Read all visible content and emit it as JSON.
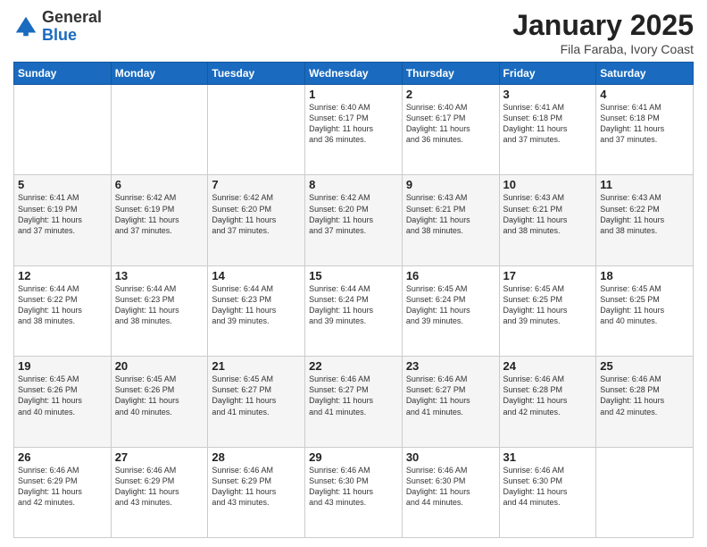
{
  "logo": {
    "general": "General",
    "blue": "Blue"
  },
  "header": {
    "title": "January 2025",
    "subtitle": "Fila Faraba, Ivory Coast"
  },
  "weekdays": [
    "Sunday",
    "Monday",
    "Tuesday",
    "Wednesday",
    "Thursday",
    "Friday",
    "Saturday"
  ],
  "weeks": [
    [
      {
        "day": "",
        "info": ""
      },
      {
        "day": "",
        "info": ""
      },
      {
        "day": "",
        "info": ""
      },
      {
        "day": "1",
        "info": "Sunrise: 6:40 AM\nSunset: 6:17 PM\nDaylight: 11 hours\nand 36 minutes."
      },
      {
        "day": "2",
        "info": "Sunrise: 6:40 AM\nSunset: 6:17 PM\nDaylight: 11 hours\nand 36 minutes."
      },
      {
        "day": "3",
        "info": "Sunrise: 6:41 AM\nSunset: 6:18 PM\nDaylight: 11 hours\nand 37 minutes."
      },
      {
        "day": "4",
        "info": "Sunrise: 6:41 AM\nSunset: 6:18 PM\nDaylight: 11 hours\nand 37 minutes."
      }
    ],
    [
      {
        "day": "5",
        "info": "Sunrise: 6:41 AM\nSunset: 6:19 PM\nDaylight: 11 hours\nand 37 minutes."
      },
      {
        "day": "6",
        "info": "Sunrise: 6:42 AM\nSunset: 6:19 PM\nDaylight: 11 hours\nand 37 minutes."
      },
      {
        "day": "7",
        "info": "Sunrise: 6:42 AM\nSunset: 6:20 PM\nDaylight: 11 hours\nand 37 minutes."
      },
      {
        "day": "8",
        "info": "Sunrise: 6:42 AM\nSunset: 6:20 PM\nDaylight: 11 hours\nand 37 minutes."
      },
      {
        "day": "9",
        "info": "Sunrise: 6:43 AM\nSunset: 6:21 PM\nDaylight: 11 hours\nand 38 minutes."
      },
      {
        "day": "10",
        "info": "Sunrise: 6:43 AM\nSunset: 6:21 PM\nDaylight: 11 hours\nand 38 minutes."
      },
      {
        "day": "11",
        "info": "Sunrise: 6:43 AM\nSunset: 6:22 PM\nDaylight: 11 hours\nand 38 minutes."
      }
    ],
    [
      {
        "day": "12",
        "info": "Sunrise: 6:44 AM\nSunset: 6:22 PM\nDaylight: 11 hours\nand 38 minutes."
      },
      {
        "day": "13",
        "info": "Sunrise: 6:44 AM\nSunset: 6:23 PM\nDaylight: 11 hours\nand 38 minutes."
      },
      {
        "day": "14",
        "info": "Sunrise: 6:44 AM\nSunset: 6:23 PM\nDaylight: 11 hours\nand 39 minutes."
      },
      {
        "day": "15",
        "info": "Sunrise: 6:44 AM\nSunset: 6:24 PM\nDaylight: 11 hours\nand 39 minutes."
      },
      {
        "day": "16",
        "info": "Sunrise: 6:45 AM\nSunset: 6:24 PM\nDaylight: 11 hours\nand 39 minutes."
      },
      {
        "day": "17",
        "info": "Sunrise: 6:45 AM\nSunset: 6:25 PM\nDaylight: 11 hours\nand 39 minutes."
      },
      {
        "day": "18",
        "info": "Sunrise: 6:45 AM\nSunset: 6:25 PM\nDaylight: 11 hours\nand 40 minutes."
      }
    ],
    [
      {
        "day": "19",
        "info": "Sunrise: 6:45 AM\nSunset: 6:26 PM\nDaylight: 11 hours\nand 40 minutes."
      },
      {
        "day": "20",
        "info": "Sunrise: 6:45 AM\nSunset: 6:26 PM\nDaylight: 11 hours\nand 40 minutes."
      },
      {
        "day": "21",
        "info": "Sunrise: 6:45 AM\nSunset: 6:27 PM\nDaylight: 11 hours\nand 41 minutes."
      },
      {
        "day": "22",
        "info": "Sunrise: 6:46 AM\nSunset: 6:27 PM\nDaylight: 11 hours\nand 41 minutes."
      },
      {
        "day": "23",
        "info": "Sunrise: 6:46 AM\nSunset: 6:27 PM\nDaylight: 11 hours\nand 41 minutes."
      },
      {
        "day": "24",
        "info": "Sunrise: 6:46 AM\nSunset: 6:28 PM\nDaylight: 11 hours\nand 42 minutes."
      },
      {
        "day": "25",
        "info": "Sunrise: 6:46 AM\nSunset: 6:28 PM\nDaylight: 11 hours\nand 42 minutes."
      }
    ],
    [
      {
        "day": "26",
        "info": "Sunrise: 6:46 AM\nSunset: 6:29 PM\nDaylight: 11 hours\nand 42 minutes."
      },
      {
        "day": "27",
        "info": "Sunrise: 6:46 AM\nSunset: 6:29 PM\nDaylight: 11 hours\nand 43 minutes."
      },
      {
        "day": "28",
        "info": "Sunrise: 6:46 AM\nSunset: 6:29 PM\nDaylight: 11 hours\nand 43 minutes."
      },
      {
        "day": "29",
        "info": "Sunrise: 6:46 AM\nSunset: 6:30 PM\nDaylight: 11 hours\nand 43 minutes."
      },
      {
        "day": "30",
        "info": "Sunrise: 6:46 AM\nSunset: 6:30 PM\nDaylight: 11 hours\nand 44 minutes."
      },
      {
        "day": "31",
        "info": "Sunrise: 6:46 AM\nSunset: 6:30 PM\nDaylight: 11 hours\nand 44 minutes."
      },
      {
        "day": "",
        "info": ""
      }
    ]
  ]
}
